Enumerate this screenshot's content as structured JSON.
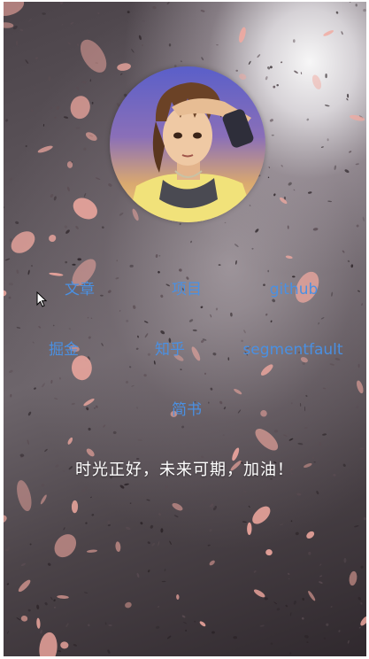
{
  "profile": {
    "avatar_icon": "anime-character-avatar"
  },
  "nav": {
    "row1": [
      "文章",
      "项目",
      "github"
    ],
    "row2": [
      "掘金",
      "知乎",
      "segmentfault"
    ],
    "row3": [
      "简书"
    ]
  },
  "motto": "时光正好，未来可期，加油！",
  "colors": {
    "link": "#4a90e2",
    "motto": "#ffffff",
    "petal": "#f2a9a0",
    "background_dark": "#3a3237",
    "background_light": "#f4f2f4"
  },
  "icons": {
    "cursor": "mouse-pointer-icon"
  }
}
